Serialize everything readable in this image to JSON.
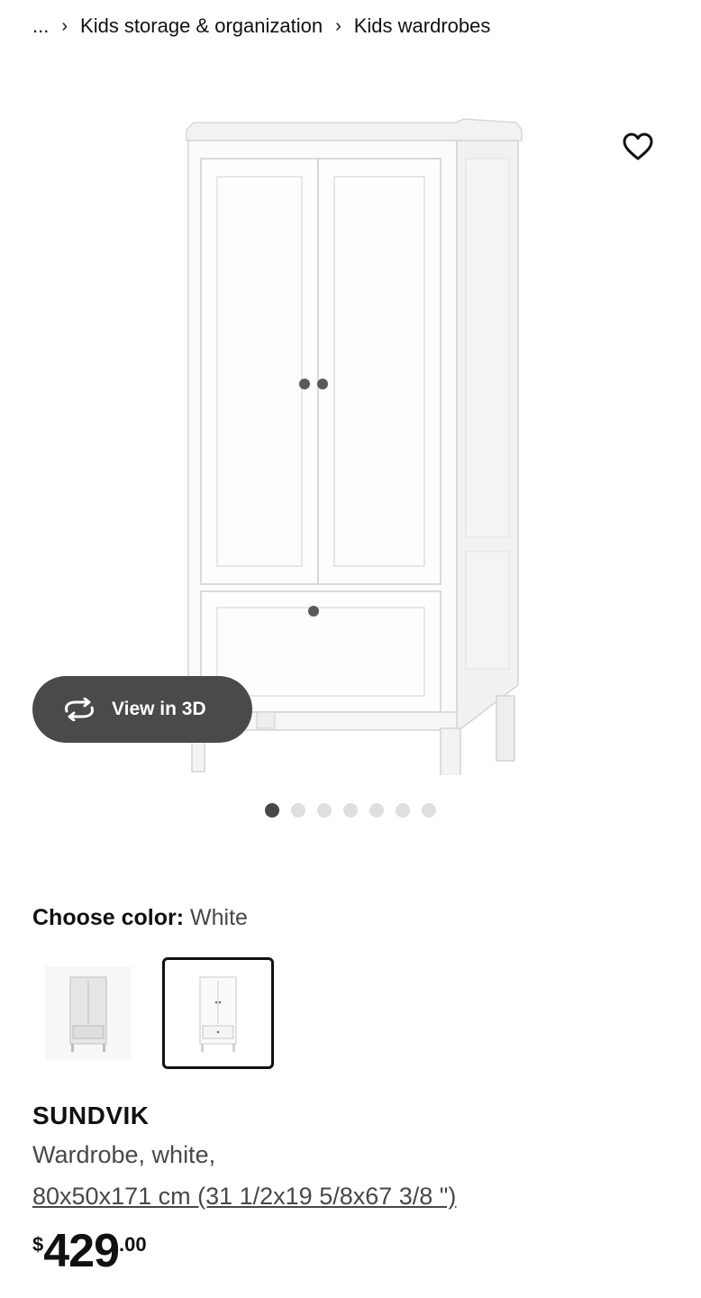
{
  "breadcrumb": {
    "ellipsis": "...",
    "items": [
      "Kids storage & organization",
      "Kids wardrobes"
    ]
  },
  "gallery": {
    "view_3d_label": "View in 3D",
    "image_count": 7,
    "active_index": 0,
    "favorite_icon": "heart-outline-icon"
  },
  "color": {
    "label": "Choose color:",
    "selected": "White",
    "options": [
      "Grey",
      "White"
    ],
    "selected_index": 1
  },
  "product": {
    "name": "SUNDVIK",
    "description": "Wardrobe, white,",
    "dimensions": "80x50x171 cm (31 1/2x19 5/8x67 3/8 \")",
    "price": {
      "currency": "$",
      "integer": "429",
      "decimal": ".00"
    }
  },
  "colors": {
    "text": "#111111",
    "secondary_text": "#484848",
    "button_bg": "#4a4a4a",
    "dot_active": "#484848",
    "dot_inactive": "#dfdfdf"
  }
}
